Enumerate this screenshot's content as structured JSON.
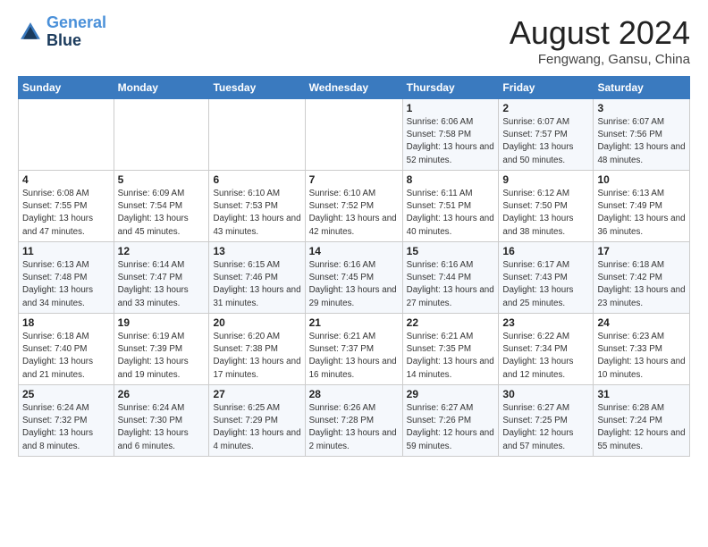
{
  "logo": {
    "line1": "General",
    "line2": "Blue"
  },
  "title": "August 2024",
  "subtitle": "Fengwang, Gansu, China",
  "days_header": [
    "Sunday",
    "Monday",
    "Tuesday",
    "Wednesday",
    "Thursday",
    "Friday",
    "Saturday"
  ],
  "weeks": [
    [
      {
        "num": "",
        "info": ""
      },
      {
        "num": "",
        "info": ""
      },
      {
        "num": "",
        "info": ""
      },
      {
        "num": "",
        "info": ""
      },
      {
        "num": "1",
        "info": "Sunrise: 6:06 AM\nSunset: 7:58 PM\nDaylight: 13 hours\nand 52 minutes."
      },
      {
        "num": "2",
        "info": "Sunrise: 6:07 AM\nSunset: 7:57 PM\nDaylight: 13 hours\nand 50 minutes."
      },
      {
        "num": "3",
        "info": "Sunrise: 6:07 AM\nSunset: 7:56 PM\nDaylight: 13 hours\nand 48 minutes."
      }
    ],
    [
      {
        "num": "4",
        "info": "Sunrise: 6:08 AM\nSunset: 7:55 PM\nDaylight: 13 hours\nand 47 minutes."
      },
      {
        "num": "5",
        "info": "Sunrise: 6:09 AM\nSunset: 7:54 PM\nDaylight: 13 hours\nand 45 minutes."
      },
      {
        "num": "6",
        "info": "Sunrise: 6:10 AM\nSunset: 7:53 PM\nDaylight: 13 hours\nand 43 minutes."
      },
      {
        "num": "7",
        "info": "Sunrise: 6:10 AM\nSunset: 7:52 PM\nDaylight: 13 hours\nand 42 minutes."
      },
      {
        "num": "8",
        "info": "Sunrise: 6:11 AM\nSunset: 7:51 PM\nDaylight: 13 hours\nand 40 minutes."
      },
      {
        "num": "9",
        "info": "Sunrise: 6:12 AM\nSunset: 7:50 PM\nDaylight: 13 hours\nand 38 minutes."
      },
      {
        "num": "10",
        "info": "Sunrise: 6:13 AM\nSunset: 7:49 PM\nDaylight: 13 hours\nand 36 minutes."
      }
    ],
    [
      {
        "num": "11",
        "info": "Sunrise: 6:13 AM\nSunset: 7:48 PM\nDaylight: 13 hours\nand 34 minutes."
      },
      {
        "num": "12",
        "info": "Sunrise: 6:14 AM\nSunset: 7:47 PM\nDaylight: 13 hours\nand 33 minutes."
      },
      {
        "num": "13",
        "info": "Sunrise: 6:15 AM\nSunset: 7:46 PM\nDaylight: 13 hours\nand 31 minutes."
      },
      {
        "num": "14",
        "info": "Sunrise: 6:16 AM\nSunset: 7:45 PM\nDaylight: 13 hours\nand 29 minutes."
      },
      {
        "num": "15",
        "info": "Sunrise: 6:16 AM\nSunset: 7:44 PM\nDaylight: 13 hours\nand 27 minutes."
      },
      {
        "num": "16",
        "info": "Sunrise: 6:17 AM\nSunset: 7:43 PM\nDaylight: 13 hours\nand 25 minutes."
      },
      {
        "num": "17",
        "info": "Sunrise: 6:18 AM\nSunset: 7:42 PM\nDaylight: 13 hours\nand 23 minutes."
      }
    ],
    [
      {
        "num": "18",
        "info": "Sunrise: 6:18 AM\nSunset: 7:40 PM\nDaylight: 13 hours\nand 21 minutes."
      },
      {
        "num": "19",
        "info": "Sunrise: 6:19 AM\nSunset: 7:39 PM\nDaylight: 13 hours\nand 19 minutes."
      },
      {
        "num": "20",
        "info": "Sunrise: 6:20 AM\nSunset: 7:38 PM\nDaylight: 13 hours\nand 17 minutes."
      },
      {
        "num": "21",
        "info": "Sunrise: 6:21 AM\nSunset: 7:37 PM\nDaylight: 13 hours\nand 16 minutes."
      },
      {
        "num": "22",
        "info": "Sunrise: 6:21 AM\nSunset: 7:35 PM\nDaylight: 13 hours\nand 14 minutes."
      },
      {
        "num": "23",
        "info": "Sunrise: 6:22 AM\nSunset: 7:34 PM\nDaylight: 13 hours\nand 12 minutes."
      },
      {
        "num": "24",
        "info": "Sunrise: 6:23 AM\nSunset: 7:33 PM\nDaylight: 13 hours\nand 10 minutes."
      }
    ],
    [
      {
        "num": "25",
        "info": "Sunrise: 6:24 AM\nSunset: 7:32 PM\nDaylight: 13 hours\nand 8 minutes."
      },
      {
        "num": "26",
        "info": "Sunrise: 6:24 AM\nSunset: 7:30 PM\nDaylight: 13 hours\nand 6 minutes."
      },
      {
        "num": "27",
        "info": "Sunrise: 6:25 AM\nSunset: 7:29 PM\nDaylight: 13 hours\nand 4 minutes."
      },
      {
        "num": "28",
        "info": "Sunrise: 6:26 AM\nSunset: 7:28 PM\nDaylight: 13 hours\nand 2 minutes."
      },
      {
        "num": "29",
        "info": "Sunrise: 6:27 AM\nSunset: 7:26 PM\nDaylight: 12 hours\nand 59 minutes."
      },
      {
        "num": "30",
        "info": "Sunrise: 6:27 AM\nSunset: 7:25 PM\nDaylight: 12 hours\nand 57 minutes."
      },
      {
        "num": "31",
        "info": "Sunrise: 6:28 AM\nSunset: 7:24 PM\nDaylight: 12 hours\nand 55 minutes."
      }
    ]
  ]
}
